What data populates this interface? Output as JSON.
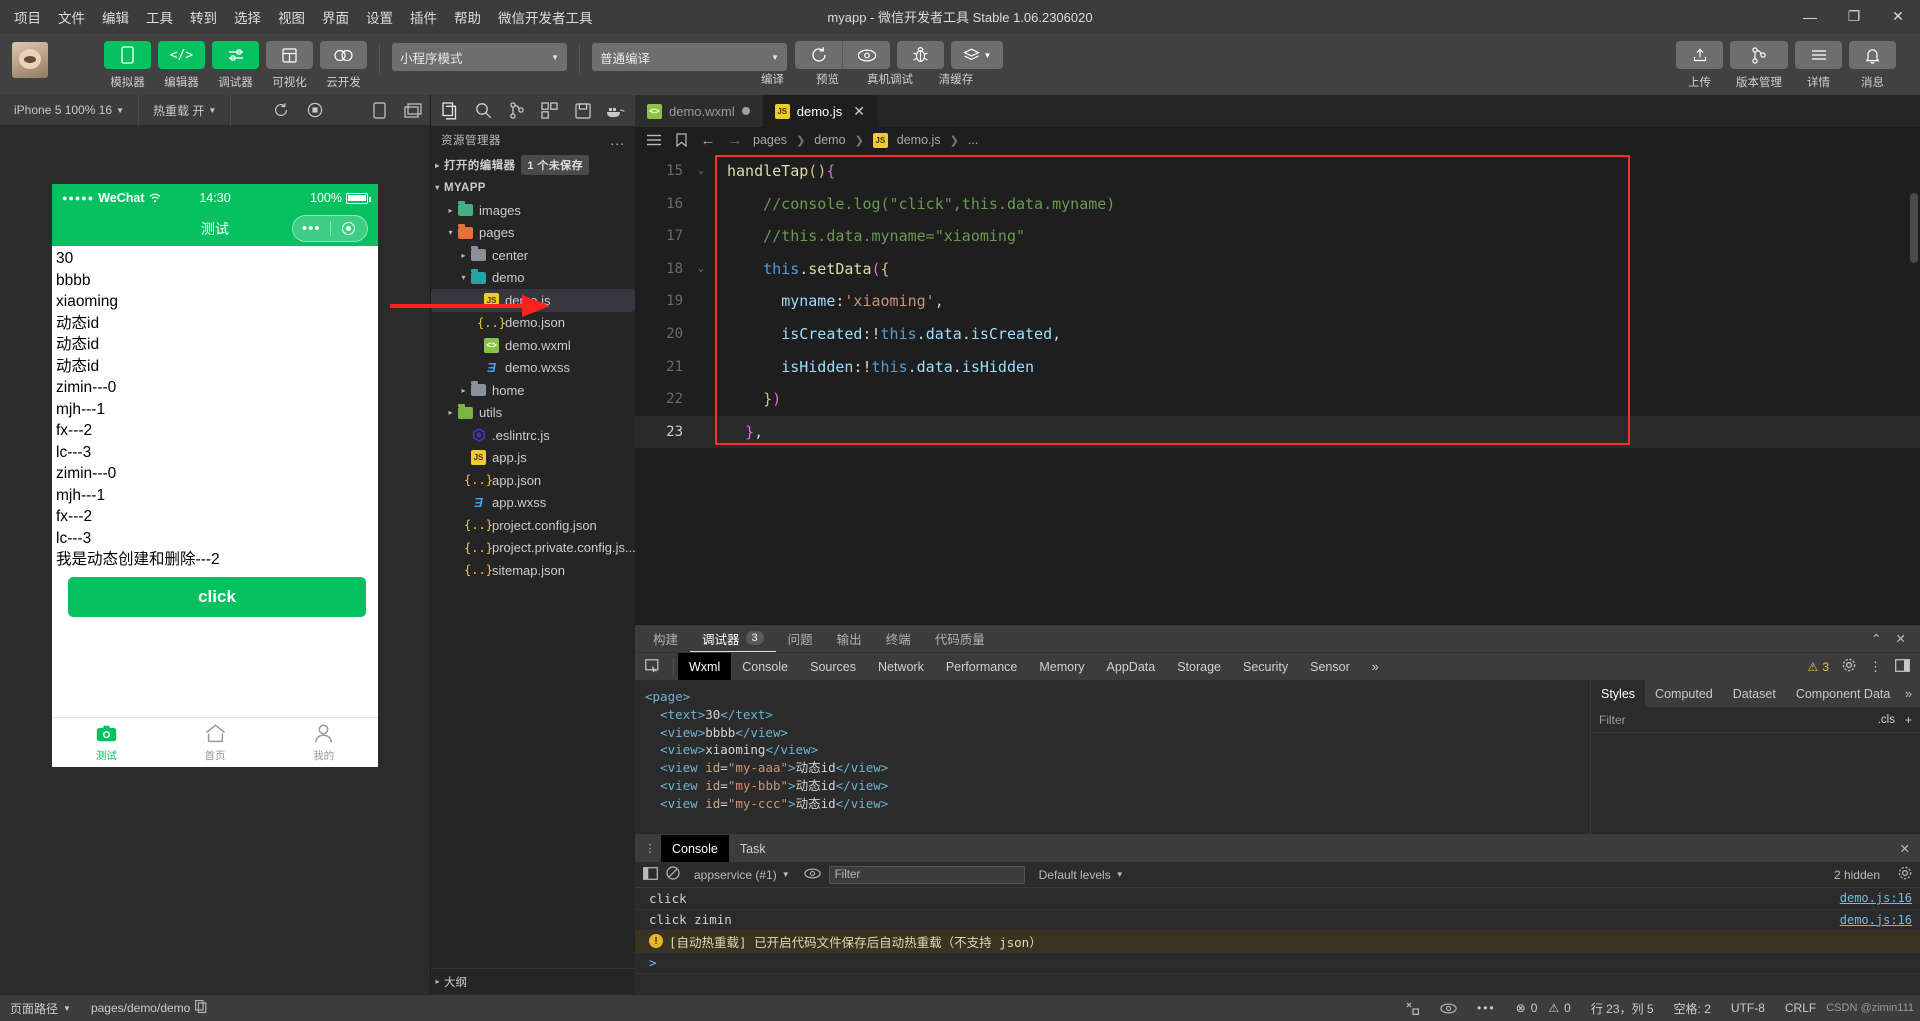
{
  "titlebar": {
    "menus": [
      "项目",
      "文件",
      "编辑",
      "工具",
      "转到",
      "选择",
      "视图",
      "界面",
      "设置",
      "插件",
      "帮助",
      "微信开发者工具"
    ],
    "title": "myapp - 微信开发者工具 Stable 1.06.2306020",
    "minimize": "—",
    "maximize": "❐",
    "close": "✕"
  },
  "toolbar": {
    "modes": [
      {
        "label": "模拟器",
        "icon": "phone-icon",
        "style": "green"
      },
      {
        "label": "编辑器",
        "icon": "code-icon",
        "style": "green"
      },
      {
        "label": "调试器",
        "icon": "sliders-icon",
        "style": "green"
      },
      {
        "label": "可视化",
        "icon": "layout-icon",
        "style": "gray"
      },
      {
        "label": "云开发",
        "icon": "cloud-icon",
        "style": "gray"
      }
    ],
    "project_mode": "小程序模式",
    "compile_mode": "普通编译",
    "actions": [
      {
        "label": "编译",
        "icon": "refresh-icon"
      },
      {
        "label": "预览",
        "icon": "eye-icon"
      },
      {
        "label": "真机调试",
        "icon": "bug-icon"
      },
      {
        "label": "清缓存",
        "icon": "layers-icon"
      }
    ],
    "right_actions": [
      {
        "label": "上传",
        "icon": "upload-icon"
      },
      {
        "label": "版本管理",
        "icon": "branch-icon"
      },
      {
        "label": "详情",
        "icon": "menu-icon"
      },
      {
        "label": "消息",
        "icon": "bell-icon"
      }
    ]
  },
  "simulator": {
    "device": "iPhone 5 100% 16",
    "hotreload": "热重载 开",
    "refresh_icon": "refresh-icon",
    "stop_icon": "stop-icon",
    "phone_icon": "phone-icon",
    "window_icon": "window-icon",
    "status": {
      "carrier": "WeChat",
      "wifi": "wifi-icon",
      "time": "14:30",
      "battery": "100%"
    },
    "nav_title": "测试",
    "page_lines": [
      "30",
      "bbbb",
      "xiaoming",
      "动态id",
      "动态id",
      "动态id",
      "zimin---0",
      "mjh---1",
      "fx---2",
      "lc---3",
      "zimin---0",
      "mjh---1",
      "fx---2",
      "lc---3",
      "我是动态创建和删除---2"
    ],
    "button_label": "click",
    "tabbar": [
      {
        "label": "测试",
        "icon": "camera-icon",
        "active": true
      },
      {
        "label": "首页",
        "icon": "home-icon",
        "active": false
      },
      {
        "label": "我的",
        "icon": "user-icon",
        "active": false
      }
    ]
  },
  "explorer": {
    "icons": [
      "files-icon",
      "search-icon",
      "source-control-icon",
      "extensions-icon",
      "save-icon",
      "docker-icon"
    ],
    "title": "资源管理器",
    "more": "...",
    "open_editors": {
      "label": "打开的编辑器",
      "badge": "1 个未保存"
    },
    "project": "MYAPP",
    "tree": [
      {
        "label": "images",
        "type": "folder",
        "depth": 1,
        "caret": "▸",
        "color": "#3fb27f"
      },
      {
        "label": "pages",
        "type": "folder",
        "depth": 1,
        "caret": "▾",
        "color": "#e8703a"
      },
      {
        "label": "center",
        "type": "folder",
        "depth": 2,
        "caret": "▸",
        "color": "#8a9199"
      },
      {
        "label": "demo",
        "type": "folder",
        "depth": 2,
        "caret": "▾",
        "color": "#27a3a3"
      },
      {
        "label": "demo.js",
        "type": "js",
        "depth": 3,
        "caret": "",
        "selected": true
      },
      {
        "label": "demo.json",
        "type": "json",
        "depth": 3,
        "caret": ""
      },
      {
        "label": "demo.wxml",
        "type": "wxml",
        "depth": 3,
        "caret": ""
      },
      {
        "label": "demo.wxss",
        "type": "wxss",
        "depth": 3,
        "caret": ""
      },
      {
        "label": "home",
        "type": "folder",
        "depth": 2,
        "caret": "▸",
        "color": "#8a9199"
      },
      {
        "label": "utils",
        "type": "folder",
        "depth": 1,
        "caret": "▸",
        "color": "#7cb342"
      },
      {
        "label": ".eslintrc.js",
        "type": "eslint",
        "depth": 1,
        "caret": ""
      },
      {
        "label": "app.js",
        "type": "js",
        "depth": 1,
        "caret": ""
      },
      {
        "label": "app.json",
        "type": "json",
        "depth": 1,
        "caret": ""
      },
      {
        "label": "app.wxss",
        "type": "wxss",
        "depth": 1,
        "caret": ""
      },
      {
        "label": "project.config.json",
        "type": "json",
        "depth": 1,
        "caret": ""
      },
      {
        "label": "project.private.config.js...",
        "type": "json",
        "depth": 1,
        "caret": ""
      },
      {
        "label": "sitemap.json",
        "type": "json",
        "depth": 1,
        "caret": ""
      }
    ],
    "outline": "大纲"
  },
  "editor": {
    "tabs": [
      {
        "label": "demo.wxml",
        "icon": "wxml-icon",
        "modified": true,
        "active": false
      },
      {
        "label": "demo.js",
        "icon": "js-icon",
        "modified": false,
        "active": true,
        "close": "✕"
      }
    ],
    "breadcrumb": [
      "pages",
      "demo",
      "demo.js",
      "..."
    ],
    "nav_back": "←",
    "nav_fwd": "→",
    "list_icon": "list-icon",
    "bookmark_icon": "bookmark-icon",
    "lines": [
      {
        "n": "15",
        "fold": "⌄",
        "text": "handleTap(){"
      },
      {
        "n": "16",
        "fold": "",
        "text": "  //console.log(\"click\",this.data.myname)"
      },
      {
        "n": "17",
        "fold": "",
        "text": "  //this.data.myname=\"xiaoming\""
      },
      {
        "n": "18",
        "fold": "⌄",
        "text": "  this.setData({"
      },
      {
        "n": "19",
        "fold": "",
        "text": "    myname:'xiaoming',"
      },
      {
        "n": "20",
        "fold": "",
        "text": "    isCreated:!this.data.isCreated,"
      },
      {
        "n": "21",
        "fold": "",
        "text": "    isHidden:!this.data.isHidden"
      },
      {
        "n": "22",
        "fold": "",
        "text": "  })"
      },
      {
        "n": "23",
        "fold": "",
        "text": "},",
        "current": true
      }
    ]
  },
  "debugger": {
    "tabs": [
      {
        "label": "构建",
        "active": false
      },
      {
        "label": "调试器",
        "active": true,
        "badge": "3"
      },
      {
        "label": "问题",
        "active": false
      },
      {
        "label": "输出",
        "active": false
      },
      {
        "label": "终端",
        "active": false
      },
      {
        "label": "代码质量",
        "active": false
      }
    ],
    "collapse_icon": "chevron-up-icon",
    "close_icon": "close-icon",
    "devtools_tabs": [
      "Wxml",
      "Console",
      "Sources",
      "Network",
      "Performance",
      "Memory",
      "AppData",
      "Storage",
      "Security",
      "Sensor"
    ],
    "devtools_active": "Wxml",
    "overflow": "»",
    "warning_count": "3",
    "gear_icon": "gear-icon",
    "kebab_icon": "kebab-icon",
    "dock_icon": "dock-icon",
    "picker_icon": "inspect-icon",
    "wxml_lines": [
      "<page>",
      "  <text>30</text>",
      "  <view>bbbb</view>",
      "  <view>xiaoming</view>",
      "  <view id=\"my-aaa\">动态id</view>",
      "  <view id=\"my-bbb\">动态id</view>",
      "  <view id=\"my-ccc\">动态id</view>"
    ],
    "styles_tabs": [
      "Styles",
      "Computed",
      "Dataset",
      "Component Data"
    ],
    "styles_active": "Styles",
    "styles_more": "»",
    "filter_placeholder": "Filter",
    "cls_label": ".cls",
    "plus_label": "+"
  },
  "console": {
    "tabs": [
      {
        "label": "Console",
        "active": true
      },
      {
        "label": "Task",
        "active": false
      }
    ],
    "close": "✕",
    "context": "appservice (#1)",
    "filter_placeholder": "Filter",
    "levels": "Default levels",
    "hidden": "2 hidden",
    "gear_icon": "gear-icon",
    "clear_icon": "clear-icon",
    "sidebar_icon": "panel-icon",
    "eye_icon": "eye-icon",
    "messages": [
      {
        "text": "click",
        "source": "demo.js:16",
        "type": "log"
      },
      {
        "text": "click zimin",
        "source": "demo.js:16",
        "type": "log"
      },
      {
        "text": "[自动热重载] 已开启代码文件保存后自动热重载（不支持 json）",
        "source": "",
        "type": "warn"
      },
      {
        "text": ">",
        "source": "",
        "type": "prompt"
      }
    ]
  },
  "statusbar": {
    "left": [
      {
        "label": "页面路径",
        "icon": "chevron-down-icon"
      },
      {
        "label": "pages/demo/demo",
        "icon": "copy-icon"
      }
    ],
    "mid": [
      {
        "label": "0",
        "icon": "error-icon"
      },
      {
        "label": "0",
        "icon": "warn-icon"
      }
    ],
    "tools": [
      "settings-icon",
      "eye-icon",
      "kebab-icon"
    ],
    "right": [
      {
        "label": "行 23，列 5"
      },
      {
        "label": "空格: 2"
      },
      {
        "label": "UTF-8"
      },
      {
        "label": "CRLF"
      }
    ],
    "watermark": "CSDN @zimin111"
  }
}
